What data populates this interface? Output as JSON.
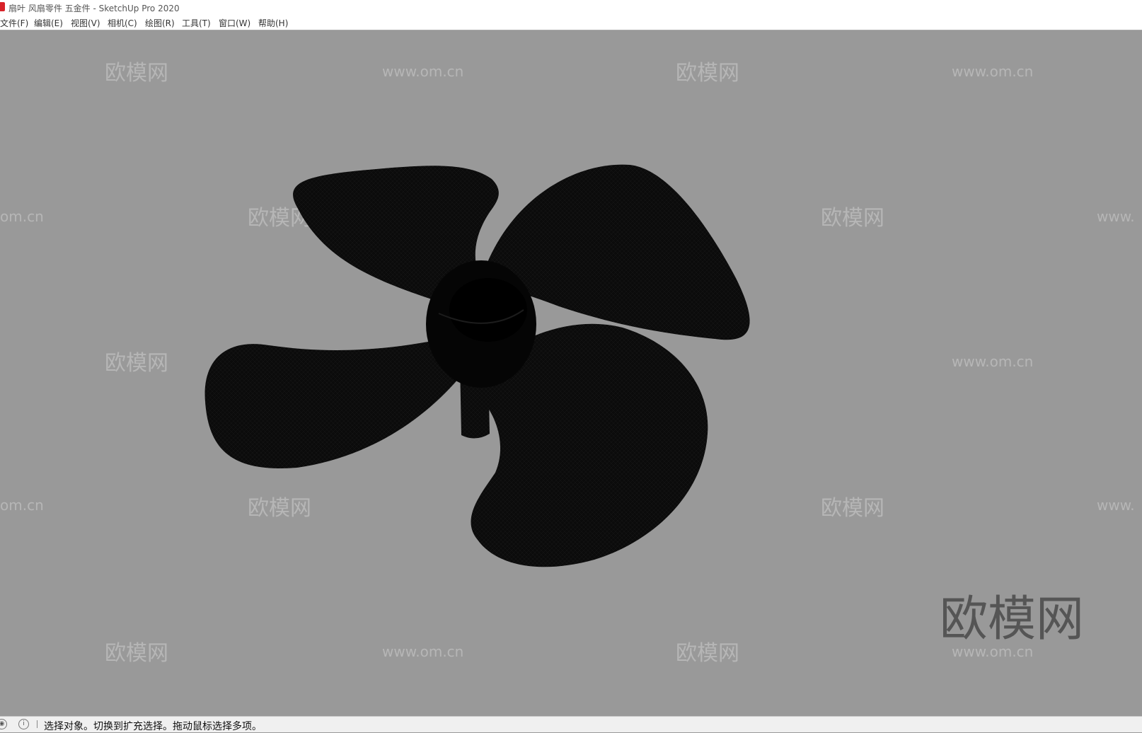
{
  "window": {
    "title": "扇叶 风扇零件 五金件 - SketchUp Pro 2020"
  },
  "menu": {
    "items": [
      {
        "label": "文件(F)"
      },
      {
        "label": "编辑(E)"
      },
      {
        "label": "视图(V)"
      },
      {
        "label": "相机(C)"
      },
      {
        "label": "绘图(R)"
      },
      {
        "label": "工具(T)"
      },
      {
        "label": "窗口(W)"
      },
      {
        "label": "帮助(H)"
      }
    ]
  },
  "viewport": {
    "model": "fan-blade",
    "background_color": "#999999",
    "model_color": "#0a0a0a",
    "watermarks": {
      "logo": "欧模网",
      "url": "www.om.cn",
      "url_partial_left": "om.cn",
      "url_partial_right": "www."
    }
  },
  "status": {
    "message": "选择对象。切换到扩充选择。拖动鼠标选择多项。",
    "icons": [
      "geo-location-icon",
      "info-icon"
    ]
  }
}
